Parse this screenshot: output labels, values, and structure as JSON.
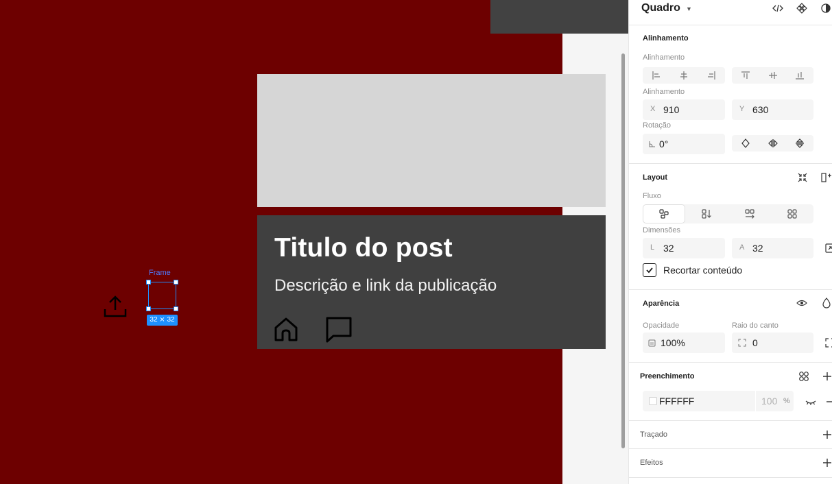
{
  "canvas": {
    "post": {
      "title": "Titulo do post",
      "description": "Descrição e link da publicação"
    },
    "selection": {
      "frame_label": "Frame",
      "size_label": "32 ⨯ 32"
    }
  },
  "panel": {
    "header": {
      "title": "Quadro"
    },
    "alignment": {
      "section_title": "Alinhamento",
      "align_label": "Alinhamento",
      "position_label": "Alinhamento",
      "x_prefix": "X",
      "x_value": "910",
      "y_prefix": "Y",
      "y_value": "630",
      "rotation_label": "Rotação",
      "rotation_value": "0°"
    },
    "layout": {
      "section_title": "Layout",
      "flow_label": "Fluxo",
      "dimensions_label": "Dimensões",
      "width_prefix": "L",
      "width_value": "32",
      "height_prefix": "A",
      "height_value": "32",
      "clip_label": "Recortar conteúdo",
      "clip_checked": true
    },
    "appearance": {
      "section_title": "Aparência",
      "opacity_label": "Opacidade",
      "opacity_value": "100%",
      "radius_label": "Raio do canto",
      "radius_value": "0"
    },
    "fill": {
      "section_title": "Preenchimento",
      "color_hex": "FFFFFF",
      "opacity": "100",
      "opacity_unit": "%"
    },
    "stroke": {
      "section_title": "Traçado"
    },
    "effects": {
      "section_title": "Efeitos"
    }
  },
  "colors": {
    "canvas_bg": "#6d0000",
    "card_bg": "#404040",
    "image_placeholder": "#d6d6d6",
    "selection_accent": "#1e90ff"
  }
}
